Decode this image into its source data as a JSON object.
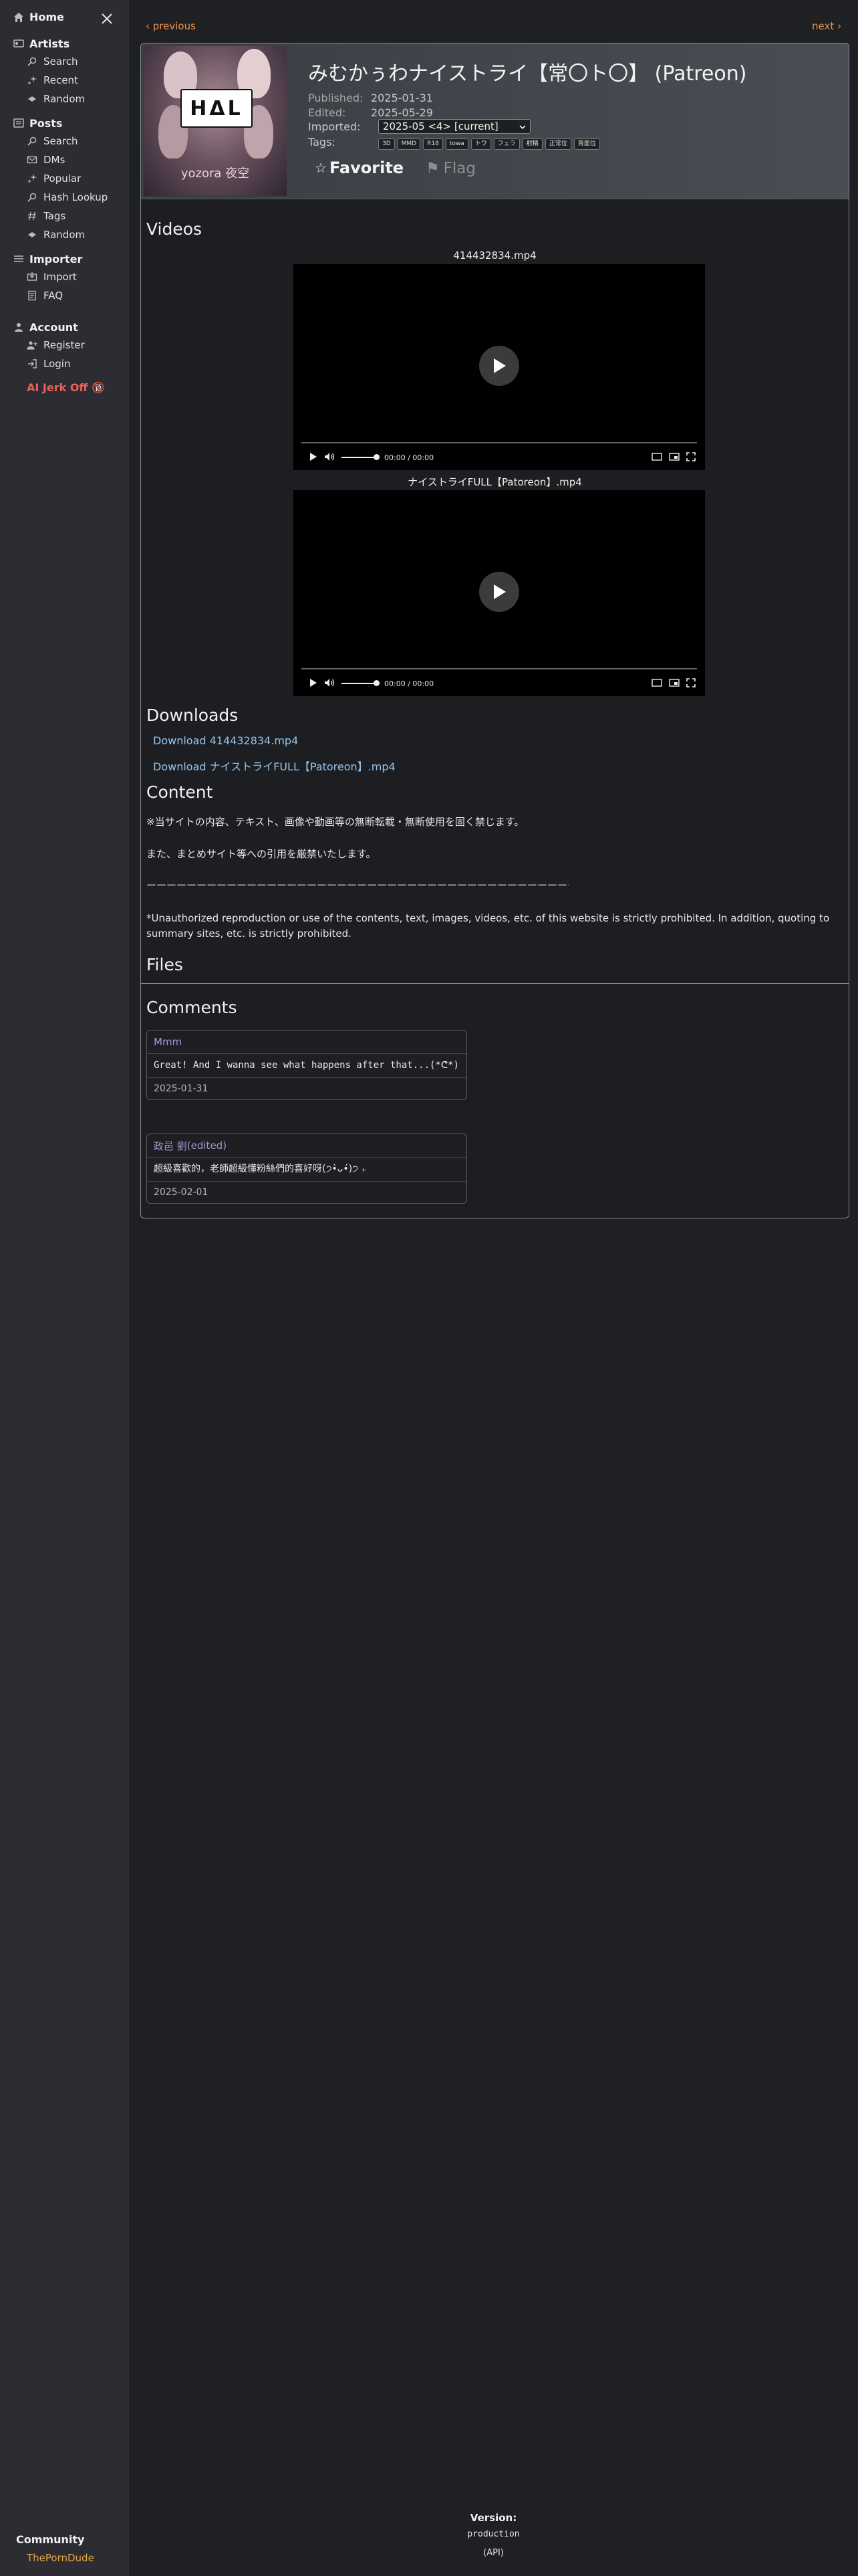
{
  "sidebar": {
    "home": "Home",
    "artists": {
      "title": "Artists",
      "items": [
        "Search",
        "Recent",
        "Random"
      ]
    },
    "posts": {
      "title": "Posts",
      "items": [
        "Search",
        "DMs",
        "Popular",
        "Hash Lookup",
        "Tags",
        "Random"
      ]
    },
    "importer": {
      "title": "Importer",
      "items": [
        "Import",
        "FAQ"
      ]
    },
    "account": {
      "title": "Account",
      "items": [
        "Register",
        "Login"
      ]
    },
    "ai_link": "AI Jerk Off 🔞",
    "community_title": "Community",
    "community_link": "ThePornDude"
  },
  "pager": {
    "previous": "‹ previous",
    "next": "next ›"
  },
  "post": {
    "artist_name": "yozora 夜空",
    "thumb_sign": "HΔL",
    "title": "みむかぅわナイストライ【常〇ト〇】 (Patreon)",
    "published_label": "Published:",
    "published": "2025-01-31",
    "edited_label": "Edited:",
    "edited": "2025-05-29",
    "imported_label": "Imported:",
    "imported_value": "2025-05 <4> [current]",
    "tags_label": "Tags:",
    "tags": [
      "3D",
      "MMD",
      "R18",
      "towa",
      "トワ",
      "フェラ",
      "射精",
      "正常位",
      "背面位"
    ],
    "favorite": "Favorite",
    "flag": "Flag"
  },
  "videos": {
    "heading": "Videos",
    "items": [
      {
        "name": "414432834.mp4",
        "time": "00:00 / 00:00"
      },
      {
        "name": "ナイストライFULL【Patoreon】.mp4",
        "time": "00:00 / 00:00"
      }
    ]
  },
  "downloads": {
    "heading": "Downloads",
    "items": [
      "Download 414432834.mp4",
      "Download ナイストライFULL【Patoreon】.mp4"
    ]
  },
  "content": {
    "heading": "Content",
    "paragraphs": [
      "※当サイトの内容、テキスト、画像や動画等の無断転載・無断使用を固く禁じます。",
      "また、まとめサイト等への引用を厳禁いたします。",
      "ーーーーーーーーーーーーーーーーーーーーーーーーーーーーーーーーーーーーーーーーーーーーーーー",
      "*Unauthorized reproduction or use of the contents, text, images, videos, etc. of this website is strictly prohibited. In addition, quoting to summary sites, etc. is strictly prohibited."
    ]
  },
  "files": {
    "heading": "Files"
  },
  "comments": {
    "heading": "Comments",
    "items": [
      {
        "author": "Mmm",
        "edited": "",
        "body": "Great! And I wanna see what happens after that...(*ᕦ*)",
        "date": "2025-01-31"
      },
      {
        "author": "政邑 劉",
        "edited": "edited",
        "body": "超級喜歡的，老師超級懂粉絲們的喜好呀(੭•̀ᴗ•́)੭ ₊",
        "date": "2025-02-01"
      }
    ]
  },
  "footer": {
    "version_label": "Version:",
    "version": "production",
    "api": "(API)"
  },
  "colors": {
    "link_orange": "#e8934c",
    "link_blue": "#93c4ee",
    "ai_red": "#e8605a",
    "comment_author": "#a993d6"
  }
}
